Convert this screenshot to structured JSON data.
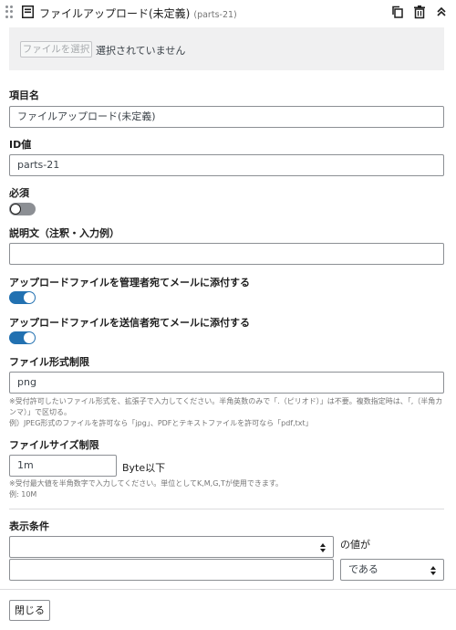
{
  "header": {
    "title": "ファイルアップロード(未定義)",
    "id_badge": "(parts-21)"
  },
  "upload": {
    "button_label": "ファイルを選択",
    "status": "選択されていません"
  },
  "fields": {
    "item_name": {
      "label": "項目名",
      "value": "ファイルアップロード(未定義)"
    },
    "id": {
      "label": "ID値",
      "value": "parts-21"
    },
    "required": {
      "label": "必須",
      "checked": false
    },
    "description": {
      "label": "説明文（注釈・入力例）",
      "value": ""
    },
    "attach_admin": {
      "label": "アップロードファイルを管理者宛てメールに添付する",
      "checked": true
    },
    "attach_sender": {
      "label": "アップロードファイルを送信者宛てメールに添付する",
      "checked": true
    },
    "file_format": {
      "label": "ファイル形式制限",
      "value": "png",
      "note_line1": "※受付許可したいファイル形式を、拡張子で入力してください。半角英数のみで「.（ピリオド）」は不要。複数指定時は、「,（半角カ",
      "note_line2": "ンマ）」で区切る。",
      "note_line3": "例）JPEG形式のファイルを許可なら「jpg」、PDFとテキストファイルを許可なら「pdf,txt」"
    },
    "file_size": {
      "label": "ファイルサイズ制限",
      "value": "1m",
      "unit": "Byte以下",
      "note_line1": "※受付最大値を半角数字で入力してください。単位としてK,M,G,Tが使用できます。",
      "note_line2": "例: 10M"
    },
    "display_condition": {
      "label": "表示条件",
      "field_select": "",
      "suffix": "の値が",
      "value_input": "",
      "operator_select": "である"
    }
  },
  "footer": {
    "close_label": "閉じる"
  },
  "colors": {
    "accent": "#2271b1",
    "border": "#8c8f94",
    "upload_bg": "#f0f0f1"
  }
}
